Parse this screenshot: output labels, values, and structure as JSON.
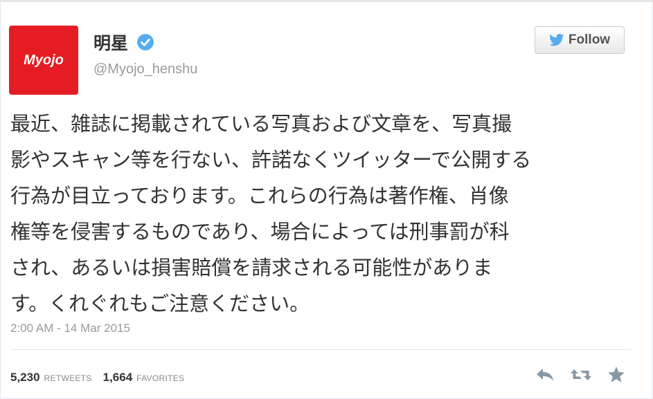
{
  "account": {
    "avatar_text": "Myojo",
    "display_name": "明星",
    "handle": "@Myojo_henshu"
  },
  "follow_button": {
    "label": "Follow",
    "icon": "twitter-bird-icon"
  },
  "tweet": {
    "lines": [
      "最近、雑誌に掲載されている写真および文章を、写真撮",
      "影やスキャン等を行ない、許諾なくツイッターで公開する",
      "行為が目立っております。これらの行為は著作権、肖像",
      "権等を侵害するものであり、場合によっては刑事罰が科",
      "され、あるいは損害賠償を請求される可能性がありま",
      "す。くれぐれもご注意ください。"
    ],
    "timestamp": "2:00 AM - 14 Mar 2015"
  },
  "stats": {
    "retweets_count": "5,230",
    "retweets_label": "RETWEETS",
    "favorites_count": "1,664",
    "favorites_label": "FAVORITES"
  },
  "actions": [
    "reply-icon",
    "retweet-icon",
    "favorite-star-icon"
  ],
  "colors": {
    "avatar_red": "#e51c23",
    "verified_blue": "#55acee",
    "twitter_blue": "#55acee",
    "text": "#333333",
    "muted": "#999999"
  }
}
